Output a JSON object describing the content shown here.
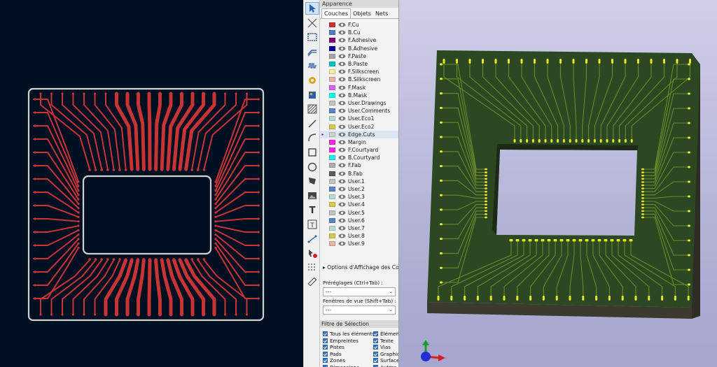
{
  "panel": {
    "title": "Apparence",
    "tabs": [
      "Couches",
      "Objets",
      "Nets"
    ],
    "layers": [
      {
        "name": "F.Cu",
        "color": "#c83434"
      },
      {
        "name": "B.Cu",
        "color": "#4d7fc4"
      },
      {
        "name": "F.Adhesive",
        "color": "#84007a"
      },
      {
        "name": "B.Adhesive",
        "color": "#0000a0"
      },
      {
        "name": "F.Paste",
        "color": "#a6a6a6"
      },
      {
        "name": "B.Paste",
        "color": "#00c2c2"
      },
      {
        "name": "F.Silkscreen",
        "color": "#f2eda1"
      },
      {
        "name": "B.Silkscreen",
        "color": "#e8b2a7"
      },
      {
        "name": "F.Mask",
        "color": "#d864ff"
      },
      {
        "name": "B.Mask",
        "color": "#02ffee"
      },
      {
        "name": "User.Drawings",
        "color": "#c2c2c2"
      },
      {
        "name": "User.Comments",
        "color": "#5984c6"
      },
      {
        "name": "User.Eco1",
        "color": "#b4dbd2"
      },
      {
        "name": "User.Eco2",
        "color": "#d8c852"
      },
      {
        "name": "Edge.Cuts",
        "color": "#d0d2cd",
        "selected": true
      },
      {
        "name": "Margin",
        "color": "#ff26e2"
      },
      {
        "name": "F.Courtyard",
        "color": "#ff26e2"
      },
      {
        "name": "B.Courtyard",
        "color": "#26e9ff"
      },
      {
        "name": "F.Fab",
        "color": "#afafaf"
      },
      {
        "name": "B.Fab",
        "color": "#5b5b5b"
      },
      {
        "name": "User.1",
        "color": "#c2c2c2"
      },
      {
        "name": "User.2",
        "color": "#5984c6"
      },
      {
        "name": "User.3",
        "color": "#b4dbd2"
      },
      {
        "name": "User.4",
        "color": "#d8c852"
      },
      {
        "name": "User.5",
        "color": "#c2c2c2"
      },
      {
        "name": "User.6",
        "color": "#5984c6"
      },
      {
        "name": "User.7",
        "color": "#b4dbd2"
      },
      {
        "name": "User.8",
        "color": "#d8c852"
      },
      {
        "name": "User.9",
        "color": "#e8b2a7"
      }
    ],
    "display_options": "Options d'Affichage des Cou",
    "presets_label": "Préréglages (Ctrl+Tab) :",
    "presets_value": "---",
    "viewports_label": "Fenêtres de vue (Shift+Tab) :",
    "viewports_value": "---"
  },
  "selection_filter": {
    "title": "Filtre de Sélection",
    "left": [
      "Tous les éléments",
      "Empreintes",
      "Pistes",
      "Pads",
      "Zones",
      "Dimensions"
    ],
    "right": [
      "Élément",
      "Texte",
      "Vias",
      "Graphiq",
      "Surface",
      "Autres"
    ]
  },
  "toolbar": {
    "tools": [
      "select-arrow",
      "local-ratsnest",
      "route-track",
      "route-diff-pair",
      "tune-length",
      "add-via",
      "add-footprint",
      "add-zone",
      "draw-line",
      "draw-arc",
      "draw-rectangle",
      "draw-circle",
      "draw-polygon",
      "add-image",
      "add-text",
      "add-textbox",
      "add-dimension",
      "delete-tool",
      "grid-origin",
      "measure-tool"
    ]
  },
  "colors": {
    "pcb_background": "#001023",
    "edge_cuts": "#d0d2cd",
    "copper_front": "#c83434",
    "board_green": "#2c4822",
    "trace_green": "#6a8a2a",
    "pad_gold": "#e6e627"
  }
}
